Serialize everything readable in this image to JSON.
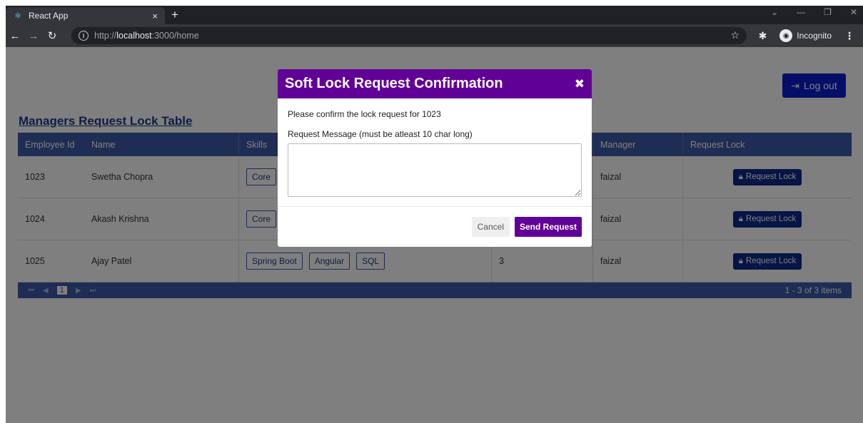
{
  "browser": {
    "tab_title": "React App",
    "tab_close": "×",
    "new_tab": "+",
    "url_prefix": "http://",
    "url_host": "localhost",
    "url_path": ":3000/home",
    "incognito_label": "Incognito"
  },
  "header": {
    "logout_label": "Log out"
  },
  "table": {
    "title": "Managers Request Lock Table",
    "columns": [
      "Employee Id",
      "Name",
      "Skills",
      "",
      "Manager",
      "Request Lock"
    ],
    "rows": [
      {
        "id": "1023",
        "name": "Swetha Chopra",
        "skills": [
          "Core"
        ],
        "exp": "",
        "manager": "faizal",
        "action": "Request Lock"
      },
      {
        "id": "1024",
        "name": "Akash Krishna",
        "skills": [
          "Core"
        ],
        "exp": "",
        "manager": "faizal",
        "action": "Request Lock"
      },
      {
        "id": "1025",
        "name": "Ajay Patel",
        "skills": [
          "Spring Boot",
          "Angular",
          "SQL"
        ],
        "exp": "3",
        "manager": "faizal",
        "action": "Request Lock"
      }
    ],
    "pager": {
      "current_page": "1",
      "info": "1 - 3 of 3 items"
    }
  },
  "modal": {
    "title": "Soft Lock Request Confirmation",
    "confirm_text": "Please confirm the lock request for 1023",
    "message_label": "Request Message (must be atleast 10 char long)",
    "message_value": "",
    "cancel_label": "Cancel",
    "send_label": "Send Request"
  },
  "colors": {
    "modal_header": "#610096",
    "grid_header": "#3d5aa7",
    "logout_button": "#0d1fd0"
  }
}
